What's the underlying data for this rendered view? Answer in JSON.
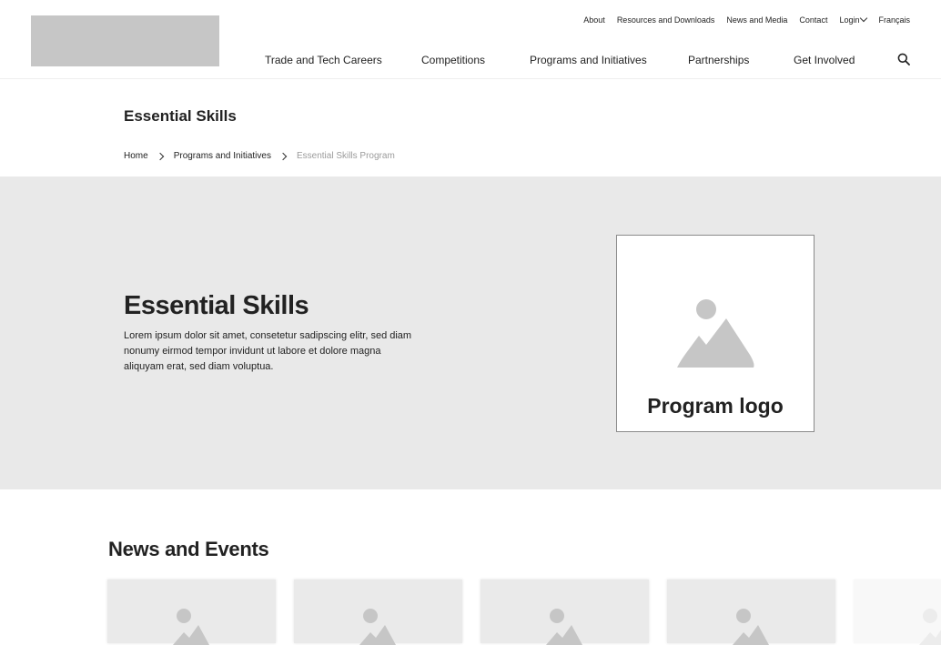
{
  "header": {
    "logo_placeholder": "site-logo",
    "utility_nav": [
      {
        "label": "About"
      },
      {
        "label": "Resources and Downloads"
      },
      {
        "label": "News and Media"
      },
      {
        "label": "Contact"
      },
      {
        "label": "Login"
      },
      {
        "label": "Français"
      }
    ],
    "main_nav": [
      {
        "label": "Trade and Tech Careers"
      },
      {
        "label": "Competitions"
      },
      {
        "label": "Programs and Initiatives"
      },
      {
        "label": "Partnerships"
      },
      {
        "label": "Get Involved"
      }
    ],
    "search_icon": "search-icon"
  },
  "page": {
    "title": "Essential Skills",
    "breadcrumb": [
      {
        "label": "Home"
      },
      {
        "label": "Programs and Initiatives"
      },
      {
        "label": "Essential Skills Program"
      }
    ]
  },
  "hero": {
    "title": "Essential Skills",
    "description": "Lorem ipsum dolor sit amet, consetetur sadipscing elitr, sed diam nonumy eirmod tempor invidunt ut labore et dolore magna aliquyam erat, sed diam voluptua.",
    "logo_label": "Program logo",
    "logo_icon": "image-placeholder-icon"
  },
  "news": {
    "title": "News and Events",
    "card_icon": "image-placeholder-icon"
  },
  "colors": {
    "hero_bg": "#e9e9e9",
    "placeholder_gray": "#c6c6c6",
    "text": "#222222",
    "breadcrumb_current": "#9b9b9b"
  }
}
